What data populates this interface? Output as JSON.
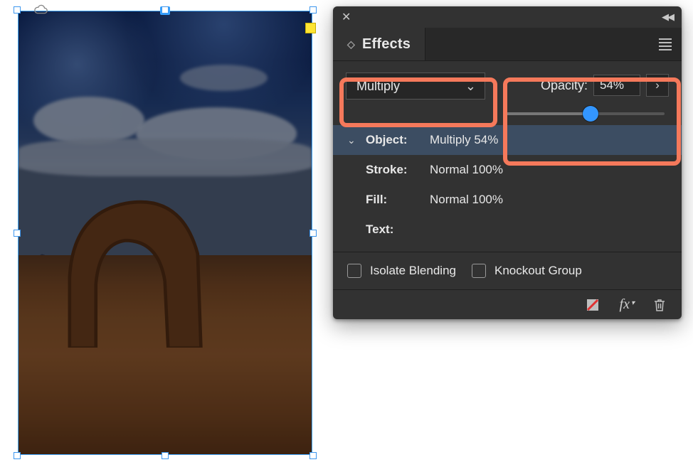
{
  "panel": {
    "title": "Effects",
    "blend_mode": "Multiply",
    "opacity_label": "Opacity:",
    "opacity_value": "54%",
    "opacity_percent": 54,
    "rows": {
      "object": {
        "label": "Object:",
        "value": "Multiply 54%"
      },
      "stroke": {
        "label": "Stroke:",
        "value": "Normal 100%"
      },
      "fill": {
        "label": "Fill:",
        "value": "Normal 100%"
      },
      "text": {
        "label": "Text:",
        "value": ""
      }
    },
    "isolate_label": "Isolate Blending",
    "knockout_label": "Knockout Group",
    "footer_icons": [
      "clear-effects-icon",
      "fx-icon",
      "trash-icon"
    ]
  },
  "highlight_color": "#f5795b",
  "selection_handle_color": "#3d97ef"
}
